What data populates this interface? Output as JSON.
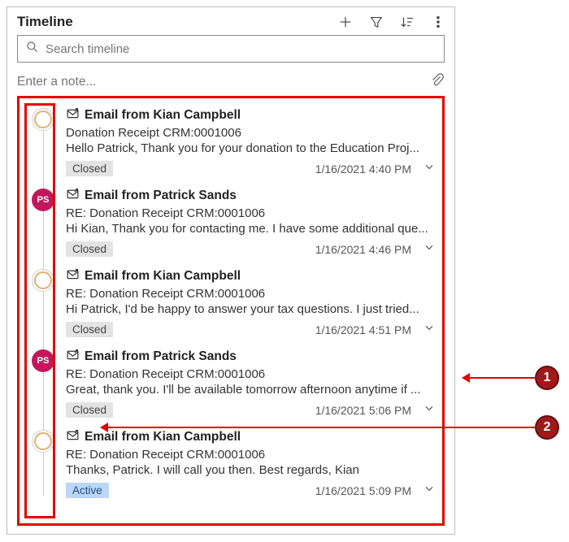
{
  "header": {
    "title": "Timeline",
    "search_placeholder": "Search timeline",
    "note_placeholder": "Enter a note..."
  },
  "callouts": [
    {
      "num": "1"
    },
    {
      "num": "2"
    }
  ],
  "items": [
    {
      "avatar_type": "kc",
      "avatar_text": "",
      "title": "Email from Kian Campbell",
      "subject": "Donation Receipt CRM:0001006",
      "preview": "Hello Patrick,   Thank you for your donation to the Education Proj...",
      "status": "Closed",
      "status_class": "closed",
      "timestamp": "1/16/2021 4:40 PM"
    },
    {
      "avatar_type": "ps",
      "avatar_text": "PS",
      "title": "Email from Patrick Sands",
      "subject": "RE: Donation Receipt CRM:0001006",
      "preview": "Hi Kian, Thank you for contacting me. I have some additional que...",
      "status": "Closed",
      "status_class": "closed",
      "timestamp": "1/16/2021 4:46 PM"
    },
    {
      "avatar_type": "kc",
      "avatar_text": "",
      "title": "Email from Kian Campbell",
      "subject": "RE: Donation Receipt CRM:0001006",
      "preview": "Hi Patrick,   I'd be happy to answer your tax questions. I just tried...",
      "status": "Closed",
      "status_class": "closed",
      "timestamp": "1/16/2021 4:51 PM"
    },
    {
      "avatar_type": "ps",
      "avatar_text": "PS",
      "title": "Email from Patrick Sands",
      "subject": "RE: Donation Receipt CRM:0001006",
      "preview": "Great, thank you. I'll be available tomorrow afternoon anytime if ...",
      "status": "Closed",
      "status_class": "closed",
      "timestamp": "1/16/2021 5:06 PM"
    },
    {
      "avatar_type": "kc",
      "avatar_text": "",
      "title": "Email from Kian Campbell",
      "subject": "RE: Donation Receipt CRM:0001006",
      "preview": "Thanks, Patrick. I will call you then.   Best regards, Kian",
      "status": "Active",
      "status_class": "active",
      "timestamp": "1/16/2021 5:09 PM"
    }
  ]
}
